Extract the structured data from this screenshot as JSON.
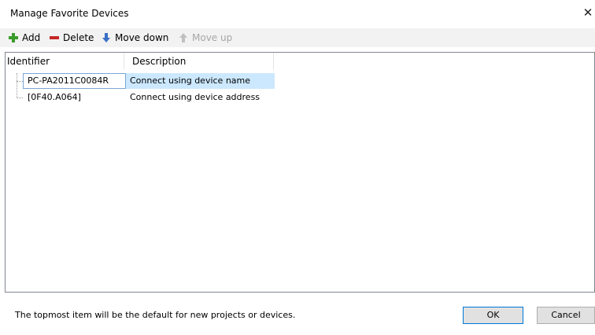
{
  "window": {
    "title": "Manage Favorite Devices",
    "close_glyph": "✕"
  },
  "toolbar": {
    "add": {
      "label": "Add",
      "icon": "plus-icon",
      "color": "#3a9a2a"
    },
    "delete": {
      "label": "Delete",
      "icon": "minus-icon",
      "color": "#c62828"
    },
    "move_down": {
      "label": "Move down",
      "icon": "arrow-down-icon",
      "color": "#3a6fc6"
    },
    "move_up": {
      "label": "Move up",
      "icon": "arrow-up-icon",
      "enabled": false
    }
  },
  "table": {
    "columns": [
      "Identifier",
      "Description"
    ],
    "rows": [
      {
        "identifier": "PC-PA2011C0084R",
        "description": "Connect using device name",
        "selected": true
      },
      {
        "identifier": "[0F40.A064]",
        "description": "Connect using device address",
        "selected": false
      }
    ]
  },
  "footer": {
    "note": "The topmost item will be the default for new projects or devices.",
    "ok_label": "OK",
    "cancel_label": "Cancel"
  },
  "colors": {
    "selection": "#cce8ff",
    "toolbar_bg": "#f2f2f2",
    "focus_border": "#0078d7"
  }
}
